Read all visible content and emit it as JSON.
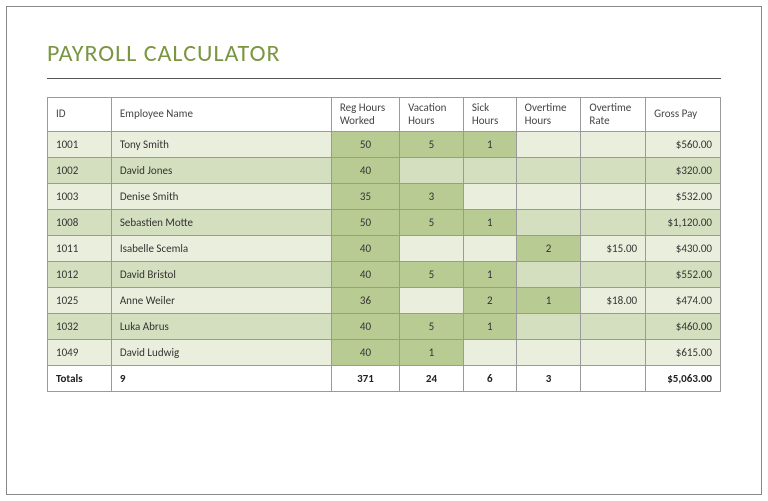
{
  "title": "PAYROLL CALCULATOR",
  "columns": {
    "id": "ID",
    "name": "Employee Name",
    "reg": "Reg Hours Worked",
    "vac": "Vacation Hours",
    "sick": "Sick Hours",
    "oth": "Overtime Hours",
    "otr": "Overtime Rate",
    "gross": "Gross Pay"
  },
  "rows": [
    {
      "id": "1001",
      "name": "Tony Smith",
      "reg": "50",
      "vac": "5",
      "sick": "1",
      "oth": "",
      "otr": "",
      "gross": "$560.00"
    },
    {
      "id": "1002",
      "name": "David Jones",
      "reg": "40",
      "vac": "",
      "sick": "",
      "oth": "",
      "otr": "",
      "gross": "$320.00"
    },
    {
      "id": "1003",
      "name": "Denise Smith",
      "reg": "35",
      "vac": "3",
      "sick": "",
      "oth": "",
      "otr": "",
      "gross": "$532.00"
    },
    {
      "id": "1008",
      "name": "Sebastien Motte",
      "reg": "50",
      "vac": "5",
      "sick": "1",
      "oth": "",
      "otr": "",
      "gross": "$1,120.00"
    },
    {
      "id": "1011",
      "name": "Isabelle Scemla",
      "reg": "40",
      "vac": "",
      "sick": "",
      "oth": "2",
      "otr": "$15.00",
      "gross": "$430.00"
    },
    {
      "id": "1012",
      "name": "David Bristol",
      "reg": "40",
      "vac": "5",
      "sick": "1",
      "oth": "",
      "otr": "",
      "gross": "$552.00"
    },
    {
      "id": "1025",
      "name": "Anne Weiler",
      "reg": "36",
      "vac": "",
      "sick": "2",
      "oth": "1",
      "otr": "$18.00",
      "gross": "$474.00"
    },
    {
      "id": "1032",
      "name": "Luka Abrus",
      "reg": "40",
      "vac": "5",
      "sick": "1",
      "oth": "",
      "otr": "",
      "gross": "$460.00"
    },
    {
      "id": "1049",
      "name": "David Ludwig",
      "reg": "40",
      "vac": "1",
      "sick": "",
      "oth": "",
      "otr": "",
      "gross": "$615.00"
    }
  ],
  "totals": {
    "label": "Totals",
    "count": "9",
    "reg": "371",
    "vac": "24",
    "sick": "6",
    "oth": "3",
    "otr": "",
    "gross": "$5,063.00"
  }
}
